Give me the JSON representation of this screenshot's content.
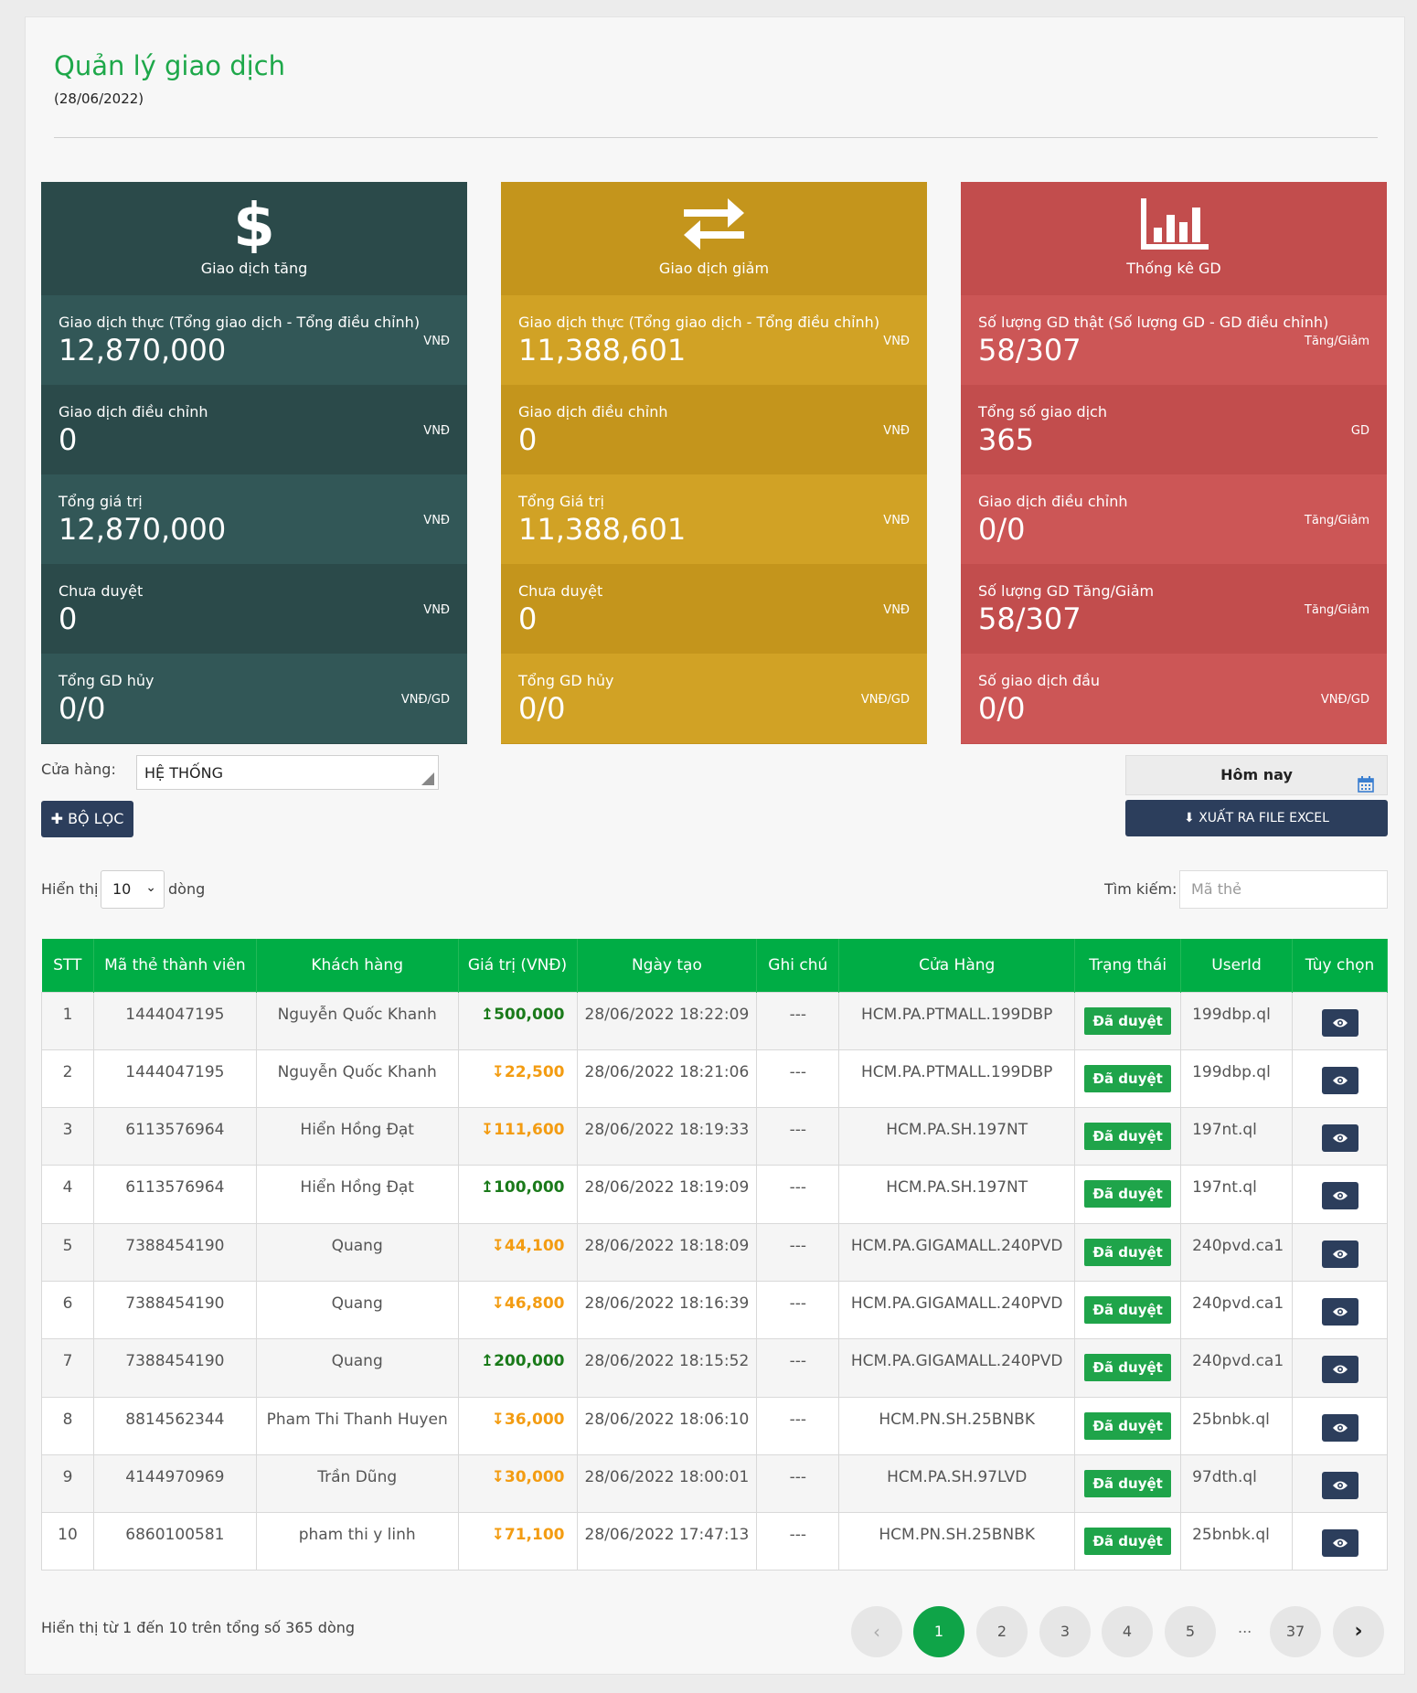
{
  "header": {
    "title": "Quản lý giao dịch",
    "date": "(28/06/2022)"
  },
  "cards": [
    {
      "caption": "Giao dịch tăng",
      "icon": "dollar-icon",
      "rows": [
        {
          "label": "Giao dịch thực (Tổng giao dịch - Tổng điều chỉnh)",
          "value": "12,870,000",
          "unit": "VNĐ"
        },
        {
          "label": "Giao dịch điều chỉnh",
          "value": "0",
          "unit": "VNĐ"
        },
        {
          "label": "Tổng giá trị",
          "value": "12,870,000",
          "unit": "VNĐ"
        },
        {
          "label": "Chưa duyệt",
          "value": "0",
          "unit": "VNĐ"
        },
        {
          "label": "Tổng GD hủy",
          "value": "0/0",
          "unit": "VNĐ/GD"
        }
      ]
    },
    {
      "caption": "Giao dịch giảm",
      "icon": "exchange-icon",
      "rows": [
        {
          "label": "Giao dịch thực (Tổng giao dịch - Tổng điều chỉnh)",
          "value": "11,388,601",
          "unit": "VNĐ"
        },
        {
          "label": "Giao dịch điều chỉnh",
          "value": "0",
          "unit": "VNĐ"
        },
        {
          "label": "Tổng Giá trị",
          "value": "11,388,601",
          "unit": "VNĐ"
        },
        {
          "label": "Chưa duyệt",
          "value": "0",
          "unit": "VNĐ"
        },
        {
          "label": "Tổng GD hủy",
          "value": "0/0",
          "unit": "VNĐ/GD"
        }
      ]
    },
    {
      "caption": "Thống kê GD",
      "icon": "bar-chart-icon",
      "rows": [
        {
          "label": "Số lượng GD thật (Số lượng GD - GD điều chỉnh)",
          "value": "58/307",
          "unit": "Tăng/Giảm"
        },
        {
          "label": "Tổng số giao dịch",
          "value": "365",
          "unit": "GD"
        },
        {
          "label": "Giao dịch điều chỉnh",
          "value": "0/0",
          "unit": "Tăng/Giảm"
        },
        {
          "label": "Số lượng GD Tăng/Giảm",
          "value": "58/307",
          "unit": "Tăng/Giảm"
        },
        {
          "label": "Số giao dịch đầu",
          "value": "0/0",
          "unit": "VNĐ/GD"
        }
      ]
    }
  ],
  "filters": {
    "store_label": "Cửa hàng:",
    "store_value": "HỆ THỐNG",
    "filter_button": "BỘ LỌC",
    "date_value": "Hôm nay",
    "excel_button": "XUẤT RA FILE EXCEL"
  },
  "list_controls": {
    "show_label": "Hiển thị",
    "page_size": "10",
    "rows_label": "dòng",
    "search_label": "Tìm kiếm:",
    "search_placeholder": "Mã thẻ"
  },
  "table": {
    "columns": [
      "STT",
      "Mã thẻ thành viên",
      "Khách hàng",
      "Giá trị (VNĐ)",
      "Ngày tạo",
      "Ghi chú",
      "Cửa Hàng",
      "Trạng thái",
      "UserId",
      "Tùy chọn"
    ],
    "rows": [
      {
        "stt": "1",
        "card": "1444047195",
        "customer": "Nguyễn Quốc Khanh",
        "amount": "500,000",
        "dir": "up",
        "created": "28/06/2022 18:22:09",
        "note": "---",
        "store": "HCM.PA.PTMALL.199DBP",
        "status": "Đã duyệt",
        "userid": "199dbp.ql"
      },
      {
        "stt": "2",
        "card": "1444047195",
        "customer": "Nguyễn Quốc Khanh",
        "amount": "22,500",
        "dir": "down",
        "created": "28/06/2022 18:21:06",
        "note": "---",
        "store": "HCM.PA.PTMALL.199DBP",
        "status": "Đã duyệt",
        "userid": "199dbp.ql"
      },
      {
        "stt": "3",
        "card": "6113576964",
        "customer": "Hiển Hồng Đạt",
        "amount": "111,600",
        "dir": "down",
        "created": "28/06/2022 18:19:33",
        "note": "---",
        "store": "HCM.PA.SH.197NT",
        "status": "Đã duyệt",
        "userid": "197nt.ql"
      },
      {
        "stt": "4",
        "card": "6113576964",
        "customer": "Hiển Hồng Đạt",
        "amount": "100,000",
        "dir": "up",
        "created": "28/06/2022 18:19:09",
        "note": "---",
        "store": "HCM.PA.SH.197NT",
        "status": "Đã duyệt",
        "userid": "197nt.ql"
      },
      {
        "stt": "5",
        "card": "7388454190",
        "customer": "Quang",
        "amount": "44,100",
        "dir": "down",
        "created": "28/06/2022 18:18:09",
        "note": "---",
        "store": "HCM.PA.GIGAMALL.240PVD",
        "status": "Đã duyệt",
        "userid": "240pvd.ca1"
      },
      {
        "stt": "6",
        "card": "7388454190",
        "customer": "Quang",
        "amount": "46,800",
        "dir": "down",
        "created": "28/06/2022 18:16:39",
        "note": "---",
        "store": "HCM.PA.GIGAMALL.240PVD",
        "status": "Đã duyệt",
        "userid": "240pvd.ca1"
      },
      {
        "stt": "7",
        "card": "7388454190",
        "customer": "Quang",
        "amount": "200,000",
        "dir": "up",
        "created": "28/06/2022 18:15:52",
        "note": "---",
        "store": "HCM.PA.GIGAMALL.240PVD",
        "status": "Đã duyệt",
        "userid": "240pvd.ca1"
      },
      {
        "stt": "8",
        "card": "8814562344",
        "customer": "Pham Thi Thanh Huyen",
        "amount": "36,000",
        "dir": "down",
        "created": "28/06/2022 18:06:10",
        "note": "---",
        "store": "HCM.PN.SH.25BNBK",
        "status": "Đã duyệt",
        "userid": "25bnbk.ql"
      },
      {
        "stt": "9",
        "card": "4144970969",
        "customer": "Trần Dũng",
        "amount": "30,000",
        "dir": "down",
        "created": "28/06/2022 18:00:01",
        "note": "---",
        "store": "HCM.PA.SH.97LVD",
        "status": "Đã duyệt",
        "userid": "97dth.ql"
      },
      {
        "stt": "10",
        "card": "6860100581",
        "customer": "pham thi y linh",
        "amount": "71,100",
        "dir": "down",
        "created": "28/06/2022 17:47:13",
        "note": "---",
        "store": "HCM.PN.SH.25BNBK",
        "status": "Đã duyệt",
        "userid": "25bnbk.ql"
      }
    ]
  },
  "pagination": {
    "info": "Hiển thị từ 1 đến 10 trên tổng số 365 dòng",
    "pages": [
      "1",
      "2",
      "3",
      "4",
      "5"
    ],
    "ellipsis": "...",
    "last": "37",
    "current": "1"
  },
  "colors": {
    "brand_green": "#1ea84a",
    "card_teal": "#2b4a4a",
    "card_gold": "#c4951c",
    "card_red": "#c24d4d",
    "navy_button": "#2c3e5c",
    "table_header": "#00ad45",
    "amount_up": "#1a7a1a",
    "amount_down": "#f39c12"
  }
}
